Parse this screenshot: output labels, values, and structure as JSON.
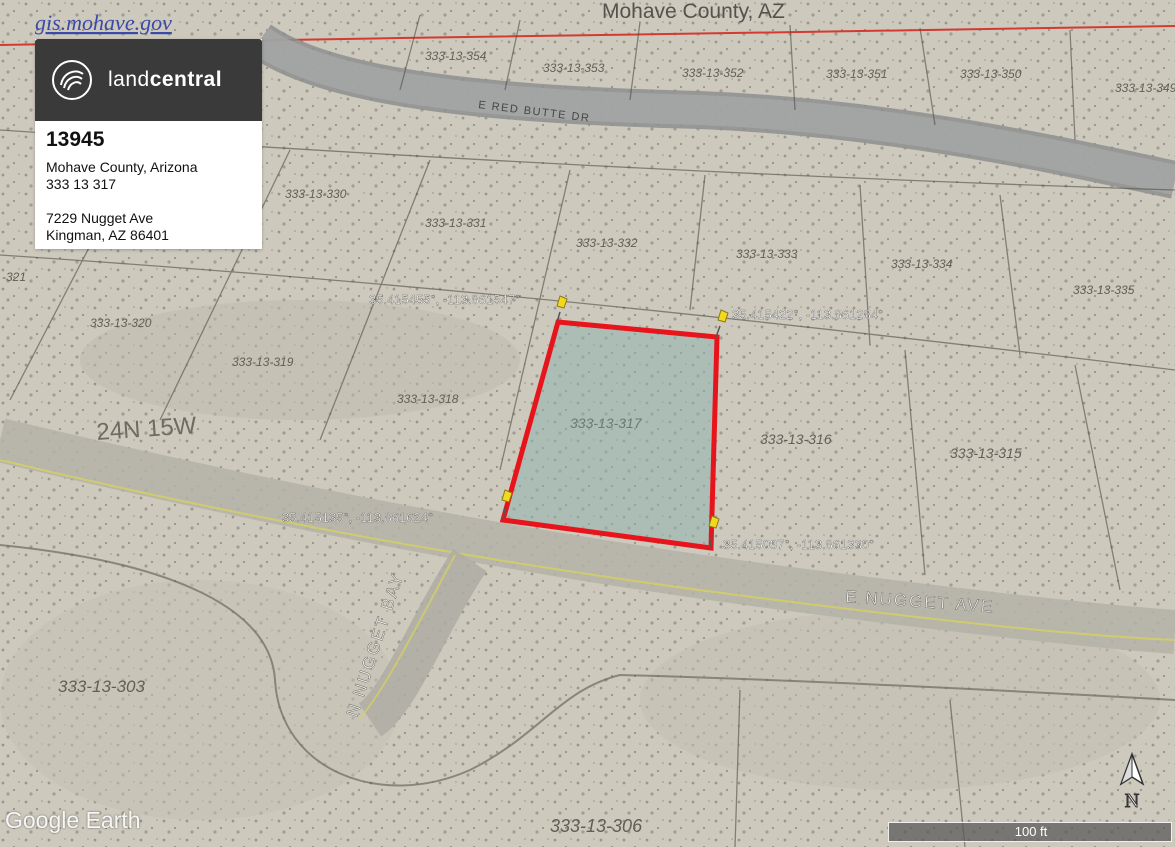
{
  "header": {
    "source_label": "gis.mohave.gov",
    "county_label": "Mohave County, AZ"
  },
  "info_card": {
    "brand": {
      "name_light": "land",
      "name_bold": "central"
    },
    "lot_number": "13945",
    "county_state": "Mohave County, Arizona",
    "parcel_id": "333 13 317",
    "address_line1": "7229 Nugget Ave",
    "address_line2": "Kingman, AZ 86401"
  },
  "map": {
    "streets": {
      "red_butte": "E RED BUTTE DR",
      "nugget_ave": "E NUGGET AVE",
      "nugget_bay": "N NUGGET BAY"
    },
    "township": "24N 15W",
    "parcels": {
      "p354": "333-13-354",
      "p353": "333-13-353",
      "p352": "333-13-352",
      "p351": "333-13-351",
      "p350": "333-13-350",
      "p349": "333-13-349",
      "p330": "333-13-330",
      "p331": "333-13-331",
      "p332": "333-13-332",
      "p333": "333-13-333",
      "p334": "333-13-334",
      "p335": "333-13-335",
      "p321": "-321",
      "p320": "333-13-320",
      "p319": "333-13-319",
      "p318": "333-13-318",
      "p317": "333-13-317",
      "p316": "333-13-316",
      "p315": "333-13-315",
      "p303": "333-13-303",
      "p306": "333-13-306"
    },
    "corners": {
      "nw": "35.415455°, -113.861547°",
      "ne": "35.415422°, -113.861284°",
      "sw": "35.415135°, -113.861624°",
      "se": "35.415097°, -113.861330°"
    },
    "boundary_color": "#e8141c",
    "fill_color": "#8fb3ad",
    "pin_color": "#f2d91e"
  },
  "footer": {
    "watermark_a": "Google",
    "watermark_b": "Earth",
    "scale_label": "100 ft",
    "north_label": "N"
  }
}
